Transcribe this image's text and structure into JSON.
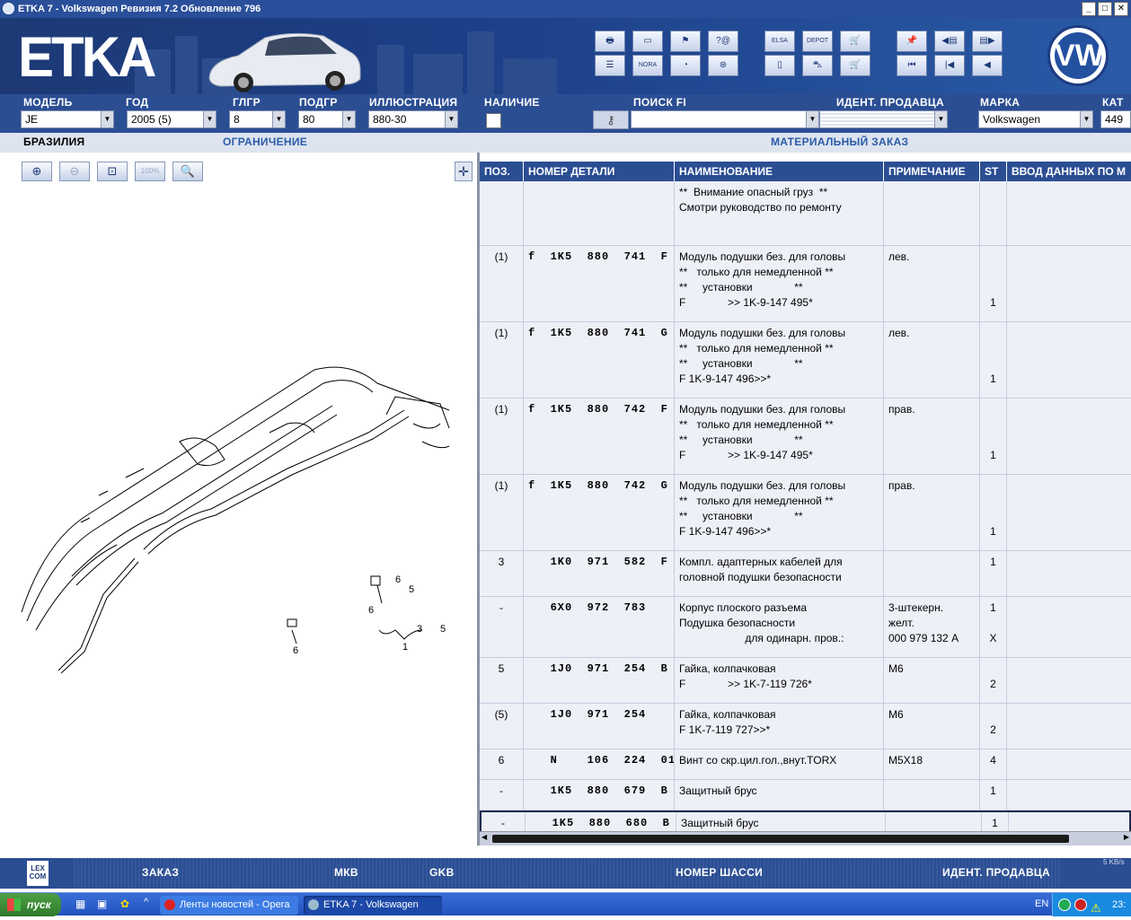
{
  "window": {
    "title": "ETKA 7 - Volkswagen Ревизия 7.2 Обновление 796"
  },
  "banner": {
    "logo": "ETKA",
    "brand_logo": "VW"
  },
  "filters": {
    "model": {
      "label": "МОДЕЛЬ",
      "value": "JE"
    },
    "year": {
      "label": "ГОД",
      "value": "2005 (5)"
    },
    "main_group": {
      "label": "ГЛГР",
      "value": "8"
    },
    "sub_group": {
      "label": "ПОДГР",
      "value": "80"
    },
    "illustration": {
      "label": "ИЛЛЮСТРАЦИЯ",
      "value": "880-30"
    },
    "availability": {
      "label": "НАЛИЧИЕ"
    },
    "search_fi": {
      "label": "ПОИСК FI",
      "value": ""
    },
    "dealer_id": {
      "label": "ИДЕНТ. ПРОДАВЦА",
      "value": ""
    },
    "brand": {
      "label": "МАРКА",
      "value": "Volkswagen"
    },
    "catalog": {
      "label": "КАТ",
      "value": "449"
    }
  },
  "subbar": {
    "region": "БРАЗИЛИЯ",
    "restriction": "ОГРАНИЧЕНИЕ",
    "material_order": "МАТЕРИАЛЬНЫЙ ЗАКАЗ"
  },
  "zoom": {
    "zoom_all_label": "100%"
  },
  "table": {
    "headers": [
      "ПОЗ.",
      "НОМЕР ДЕТАЛИ",
      "НАИМЕНОВАНИЕ",
      "ПРИМЕЧАНИЕ",
      "ST",
      "ВВОД ДАННЫХ ПО М"
    ],
    "rows": [
      {
        "pos": "",
        "part": "",
        "name": "**  Внимание опасный груз  **\nСмотри руководство по ремонту",
        "note": "",
        "st": "",
        "input": ""
      },
      {
        "pos": "(1)",
        "part": "f  1K5  880  741  F",
        "name": "Модуль подушки без. для головы\n**   только для немедленной **\n**     установки              **\nF              >> 1K-9-147 495*",
        "note": "лев.",
        "st": "\n\n\n1",
        "input": ""
      },
      {
        "pos": "(1)",
        "part": "f  1K5  880  741  G",
        "name": "Модуль подушки без. для головы\n**   только для немедленной **\n**     установки              **\nF 1K-9-147 496>>*",
        "note": "лев.",
        "st": "\n\n\n1",
        "input": ""
      },
      {
        "pos": "(1)",
        "part": "f  1K5  880  742  F",
        "name": "Модуль подушки без. для головы\n**   только для немедленной **\n**     установки              **\nF              >> 1K-9-147 495*",
        "note": "прав.",
        "st": "\n\n\n1",
        "input": ""
      },
      {
        "pos": "(1)",
        "part": "f  1K5  880  742  G",
        "name": "Модуль подушки без. для головы\n**   только для немедленной **\n**     установки              **\nF 1K-9-147 496>>*",
        "note": "прав.",
        "st": "\n\n\n1",
        "input": ""
      },
      {
        "pos": "3",
        "part": "   1K0  971  582  F",
        "name": "Компл. адаптерных кабелей для\nголовной подушки безопасности",
        "note": "",
        "st": "1",
        "input": ""
      },
      {
        "pos": "-",
        "part": "   6X0  972  783",
        "name": "Корпус плоского разъема\nПодушка безопасности\n                      для одинарн. пров.:",
        "note": "3-штекерн.\nжелт.\n000 979 132 A",
        "st": "1\n\nX",
        "input": ""
      },
      {
        "pos": "5",
        "part": "   1J0  971  254  B",
        "name": "Гайка, колпачковая\nF              >> 1K-7-119 726*",
        "note": "M6",
        "st": "\n2",
        "input": ""
      },
      {
        "pos": "(5)",
        "part": "   1J0  971  254",
        "name": "Гайка, колпачковая\nF 1K-7-119 727>>*",
        "note": "M6",
        "st": "\n2",
        "input": ""
      },
      {
        "pos": "6",
        "part": "   N    106  224  01",
        "name": "Винт со скр.цил.гол.,внут.TORX",
        "note": "M5X18",
        "st": "4",
        "input": ""
      },
      {
        "pos": "-",
        "part": "   1K5  880  679  B",
        "name": "Защитный брус",
        "note": "",
        "st": "1",
        "input": ""
      },
      {
        "pos": "-",
        "part": "   1K5  880  680  B",
        "name": "Защитный брус",
        "note": "",
        "st": "1",
        "input": ""
      }
    ]
  },
  "bottombar": {
    "lexcom": "LEX\nCOM",
    "order": "ЗАКАЗ",
    "mkv": "МКВ",
    "gkb": "GKB",
    "chassis": "НОМЕР ШАССИ",
    "dealer_id": "ИДЕНТ. ПРОДАВЦА",
    "speed": "5 KB/s"
  },
  "taskbar": {
    "start": "пуск",
    "task_opera": "Ленты новостей - Opera",
    "task_etka": "ETKA 7 - Volkswagen",
    "lang": "EN",
    "clock": "23:"
  },
  "diagram": {
    "callouts": [
      "1",
      "3",
      "5",
      "5",
      "6",
      "6",
      "6",
      "6",
      "6"
    ]
  }
}
